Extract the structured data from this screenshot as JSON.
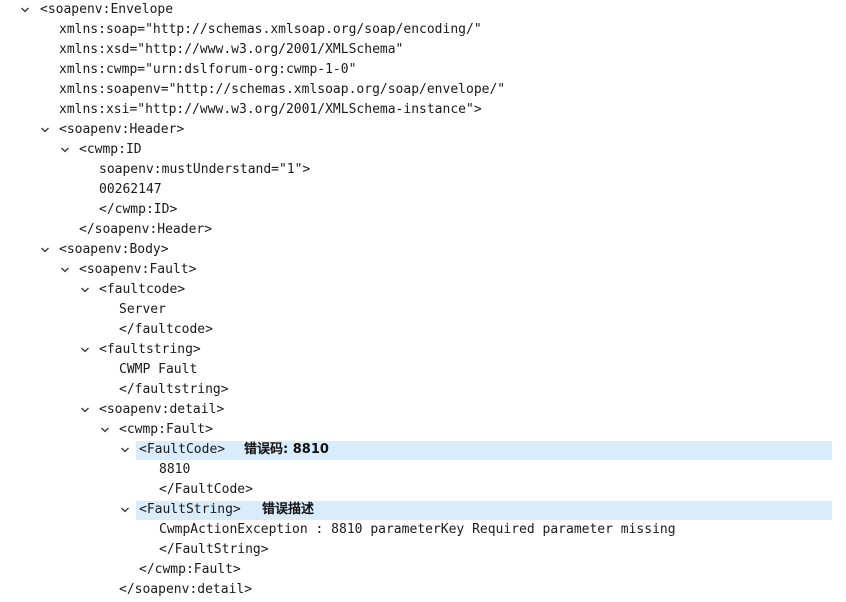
{
  "tree": {
    "envelope_open": "<soapenv:Envelope",
    "ns_soap": "xmlns:soap=\"http://schemas.xmlsoap.org/soap/encoding/\"",
    "ns_xsd": "xmlns:xsd=\"http://www.w3.org/2001/XMLSchema\"",
    "ns_cwmp": "xmlns:cwmp=\"urn:dslforum-org:cwmp-1-0\"",
    "ns_soapenv": "xmlns:soapenv=\"http://schemas.xmlsoap.org/soap/envelope/\"",
    "ns_xsi": "xmlns:xsi=\"http://www.w3.org/2001/XMLSchema-instance\">",
    "header_open": "<soapenv:Header>",
    "cwmp_id_open": "<cwmp:ID",
    "cwmp_id_attr": "soapenv:mustUnderstand=\"1\">",
    "cwmp_id_value": "00262147",
    "cwmp_id_close": "</cwmp:ID>",
    "header_close": "</soapenv:Header>",
    "body_open": "<soapenv:Body>",
    "fault_open": "<soapenv:Fault>",
    "faultcode_open": "<faultcode>",
    "faultcode_value": "Server",
    "faultcode_close": "</faultcode>",
    "faultstring_open": "<faultstring>",
    "faultstring_value": "CWMP Fault",
    "faultstring_close": "</faultstring>",
    "detail_open": "<soapenv:detail>",
    "cwmp_fault_open": "<cwmp:Fault>",
    "FaultCode_open": "<FaultCode>",
    "FaultCode_note": "错误码: 8810",
    "FaultCode_value": "8810",
    "FaultCode_close": "</FaultCode>",
    "FaultString_open": "<FaultString>",
    "FaultString_note": "错误描述",
    "FaultString_value": "CwmpActionException : 8810 parameterKey Required parameter missing",
    "FaultString_close": "</FaultString>",
    "cwmp_fault_close": "</cwmp:Fault>",
    "detail_close": "</soapenv:detail>"
  },
  "colors": {
    "highlight": "#d8ecfb",
    "chevron": "#333333"
  },
  "icons": {
    "expand": "chevron-down-icon"
  }
}
